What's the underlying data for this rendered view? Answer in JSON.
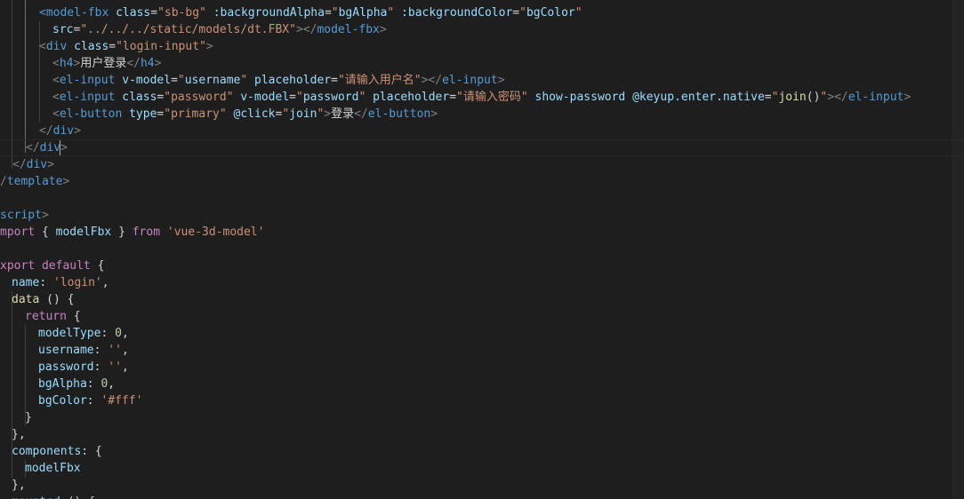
{
  "colors": {
    "background": "#1e1e1e",
    "plain": "#d4d4d4",
    "tag": "#569cd6",
    "bracket": "#808080",
    "attr": "#9cdcfe",
    "string": "#ce9178",
    "keyword": "#c586c0",
    "number": "#b5cea8",
    "function": "#dcdcaa"
  },
  "lines": [
    [
      [
        "tag",
        "<"
      ],
      [
        "tag",
        "model-fbx"
      ],
      [
        "plain",
        " "
      ],
      [
        "attr",
        "class"
      ],
      [
        "plain",
        "="
      ],
      [
        "string",
        "\"sb-bg\""
      ],
      [
        "plain",
        " "
      ],
      [
        "attr",
        ":backgroundAlpha"
      ],
      [
        "plain",
        "="
      ],
      [
        "string",
        "\""
      ],
      [
        "attr",
        "bgAlpha"
      ],
      [
        "string",
        "\""
      ],
      [
        "plain",
        " "
      ],
      [
        "attr",
        ":backgroundColor"
      ],
      [
        "plain",
        "="
      ],
      [
        "string",
        "\""
      ],
      [
        "attr",
        "bgColor"
      ],
      [
        "string",
        "\""
      ]
    ],
    [
      [
        "attr",
        "src"
      ],
      [
        "plain",
        "="
      ],
      [
        "string",
        "\"../../../static/models/dt.FBX\""
      ],
      [
        "bracket",
        ">"
      ],
      [
        "bracket",
        "</"
      ],
      [
        "tag",
        "model-fbx"
      ],
      [
        "bracket",
        ">"
      ]
    ],
    [
      [
        "bracket",
        "<"
      ],
      [
        "tag",
        "div"
      ],
      [
        "plain",
        " "
      ],
      [
        "attr",
        "class"
      ],
      [
        "plain",
        "="
      ],
      [
        "string",
        "\"login-input\""
      ],
      [
        "bracket",
        ">"
      ]
    ],
    [
      [
        "bracket",
        "<"
      ],
      [
        "tag",
        "h4"
      ],
      [
        "bracket",
        ">"
      ],
      [
        "plain",
        "用户登录"
      ],
      [
        "bracket",
        "</"
      ],
      [
        "tag",
        "h4"
      ],
      [
        "bracket",
        ">"
      ]
    ],
    [
      [
        "bracket",
        "<"
      ],
      [
        "tag",
        "el-input"
      ],
      [
        "plain",
        " "
      ],
      [
        "attr",
        "v-model"
      ],
      [
        "plain",
        "="
      ],
      [
        "string",
        "\""
      ],
      [
        "attr",
        "username"
      ],
      [
        "string",
        "\""
      ],
      [
        "plain",
        " "
      ],
      [
        "attr",
        "placeholder"
      ],
      [
        "plain",
        "="
      ],
      [
        "string",
        "\"请输入用户名\""
      ],
      [
        "bracket",
        ">"
      ],
      [
        "bracket",
        "</"
      ],
      [
        "tag",
        "el-input"
      ],
      [
        "bracket",
        ">"
      ]
    ],
    [
      [
        "bracket",
        "<"
      ],
      [
        "tag",
        "el-input"
      ],
      [
        "plain",
        " "
      ],
      [
        "attr",
        "class"
      ],
      [
        "plain",
        "="
      ],
      [
        "string",
        "\"password\""
      ],
      [
        "plain",
        " "
      ],
      [
        "attr",
        "v-model"
      ],
      [
        "plain",
        "="
      ],
      [
        "string",
        "\""
      ],
      [
        "attr",
        "password"
      ],
      [
        "string",
        "\""
      ],
      [
        "plain",
        " "
      ],
      [
        "attr",
        "placeholder"
      ],
      [
        "plain",
        "="
      ],
      [
        "string",
        "\"请输入密码\""
      ],
      [
        "plain",
        " "
      ],
      [
        "attr",
        "show-password"
      ],
      [
        "plain",
        " "
      ],
      [
        "attr",
        "@keyup.enter.native"
      ],
      [
        "plain",
        "="
      ],
      [
        "string",
        "\""
      ],
      [
        "function",
        "join"
      ],
      [
        "plain",
        "()"
      ],
      [
        "string",
        "\""
      ],
      [
        "bracket",
        ">"
      ],
      [
        "bracket",
        "</"
      ],
      [
        "tag",
        "el-input"
      ],
      [
        "bracket",
        ">"
      ]
    ],
    [
      [
        "bracket",
        "<"
      ],
      [
        "tag",
        "el-button"
      ],
      [
        "plain",
        " "
      ],
      [
        "attr",
        "type"
      ],
      [
        "plain",
        "="
      ],
      [
        "string",
        "\"primary\""
      ],
      [
        "plain",
        " "
      ],
      [
        "attr",
        "@click"
      ],
      [
        "plain",
        "="
      ],
      [
        "string",
        "\""
      ],
      [
        "attr",
        "join"
      ],
      [
        "string",
        "\""
      ],
      [
        "bracket",
        ">"
      ],
      [
        "plain",
        "登录"
      ],
      [
        "bracket",
        "</"
      ],
      [
        "tag",
        "el-button"
      ],
      [
        "bracket",
        ">"
      ]
    ],
    [
      [
        "bracket",
        "</"
      ],
      [
        "tag",
        "div"
      ],
      [
        "bracket",
        ">"
      ]
    ],
    [
      [
        "bracket",
        "</"
      ],
      [
        "tag",
        "div"
      ],
      [
        "bracket",
        ">"
      ]
    ],
    [
      [
        "bracket",
        "</"
      ],
      [
        "tag",
        "div"
      ],
      [
        "bracket",
        ">"
      ]
    ],
    [
      [
        "bracket",
        "/"
      ],
      [
        "tag",
        "template"
      ],
      [
        "bracket",
        ">"
      ]
    ],
    [],
    [
      [
        "tag",
        "script"
      ],
      [
        "bracket",
        ">"
      ]
    ],
    [
      [
        "keyword",
        "mport"
      ],
      [
        "plain",
        " { "
      ],
      [
        "attr",
        "modelFbx"
      ],
      [
        "plain",
        " } "
      ],
      [
        "keyword",
        "from"
      ],
      [
        "plain",
        " "
      ],
      [
        "string",
        "'vue-3d-model'"
      ]
    ],
    [],
    [
      [
        "keyword",
        "xport"
      ],
      [
        "plain",
        " "
      ],
      [
        "keyword",
        "default"
      ],
      [
        "plain",
        " {"
      ]
    ],
    [
      [
        "attr",
        "name"
      ],
      [
        "plain",
        ": "
      ],
      [
        "string",
        "'login'"
      ],
      [
        "plain",
        ","
      ]
    ],
    [
      [
        "function",
        "data"
      ],
      [
        "plain",
        " () {"
      ]
    ],
    [
      [
        "keyword",
        "return"
      ],
      [
        "plain",
        " {"
      ]
    ],
    [
      [
        "attr",
        "modelType"
      ],
      [
        "plain",
        ": "
      ],
      [
        "number",
        "0"
      ],
      [
        "plain",
        ","
      ]
    ],
    [
      [
        "attr",
        "username"
      ],
      [
        "plain",
        ": "
      ],
      [
        "string",
        "''"
      ],
      [
        "plain",
        ","
      ]
    ],
    [
      [
        "attr",
        "password"
      ],
      [
        "plain",
        ": "
      ],
      [
        "string",
        "''"
      ],
      [
        "plain",
        ","
      ]
    ],
    [
      [
        "attr",
        "bgAlpha"
      ],
      [
        "plain",
        ": "
      ],
      [
        "number",
        "0"
      ],
      [
        "plain",
        ","
      ]
    ],
    [
      [
        "attr",
        "bgColor"
      ],
      [
        "plain",
        ": "
      ],
      [
        "string",
        "'#fff'"
      ]
    ],
    [
      [
        "plain",
        "}"
      ]
    ],
    [
      [
        "plain",
        "},"
      ]
    ],
    [
      [
        "attr",
        "components"
      ],
      [
        "plain",
        ": {"
      ]
    ],
    [
      [
        "attr",
        "modelFbx"
      ]
    ],
    [
      [
        "plain",
        "},"
      ]
    ],
    [
      [
        "attr",
        "mounted"
      ],
      [
        "plain",
        " () {"
      ]
    ]
  ]
}
